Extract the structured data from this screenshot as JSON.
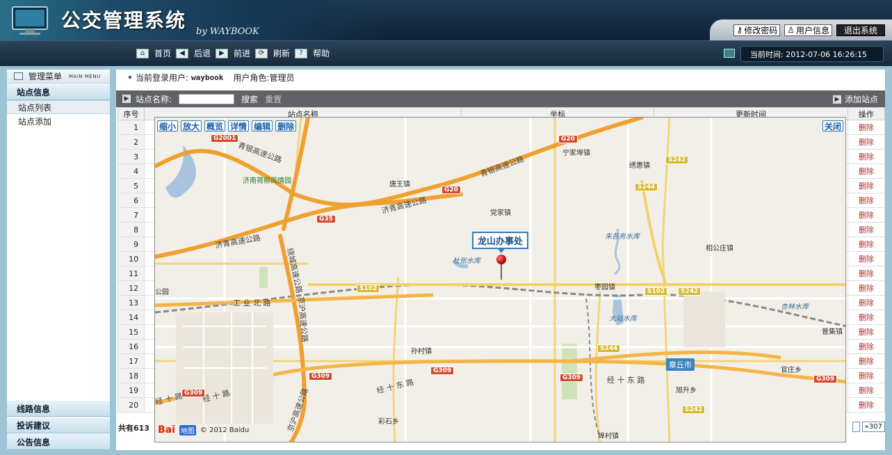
{
  "header": {
    "title": "公交管理系统",
    "subtitle": "by WAYBOOK",
    "buttons": {
      "change_password": "修改密码",
      "user_info": "用户信息",
      "logout": "退出系统"
    },
    "nav": [
      {
        "label": "首页",
        "icon": "home-icon"
      },
      {
        "label": "后退",
        "icon": "back-icon"
      },
      {
        "label": "前进",
        "icon": "forward-icon"
      },
      {
        "label": "刷新",
        "icon": "refresh-icon"
      },
      {
        "label": "帮助",
        "icon": "help-icon"
      }
    ],
    "current_time": "当前时间: 2012-07-06 16:26:15"
  },
  "sidebar": {
    "title": "管理菜单",
    "title_en": "MAIN MENU",
    "sections": {
      "station": "站点信息",
      "station_list": "站点列表",
      "station_add": "站点添加",
      "route": "线路信息",
      "complaints": "投诉建议",
      "notices": "公告信息"
    }
  },
  "content": {
    "login_label": "当前登录用户:",
    "login_user": "waybook",
    "role_label": "用户角色:",
    "role": "管理员",
    "search_label": "站点名称:",
    "search_placeholder": "",
    "search_button": "搜索",
    "reset_button": "重置",
    "add_button": "添加站点",
    "columns": [
      "序号",
      "站点名称",
      "坐标",
      "更新时间",
      "操作"
    ],
    "rows": [
      "1",
      "2",
      "3",
      "4",
      "5",
      "6",
      "7",
      "8",
      "9",
      "10",
      "11",
      "12",
      "13",
      "14",
      "15",
      "16",
      "17",
      "18",
      "19",
      "20"
    ],
    "delete_label": "删除",
    "total": "共有613",
    "last_page": "»307"
  },
  "map": {
    "tools": {
      "zoom_out": "缩小",
      "zoom_in": "放大",
      "overview": "概览",
      "detail": "详情",
      "edit": "编辑",
      "delete": "删除"
    },
    "close": "关闭",
    "marker_label": "龙山办事处",
    "copyright": "© 2012 Baidu",
    "logo": "Bai",
    "logo2": "地图",
    "places": {
      "p1": "宁家埠镇",
      "p2": "绣惠镇",
      "p3": "唐王镇",
      "p4": "党家镇",
      "p5": "济南荷柳风情园",
      "p6": "朱各务水库",
      "p7": "相公庄镇",
      "p8": "杜张水库",
      "p9": "枣园镇",
      "p10": "杏林水库",
      "p11": "大站水库",
      "p12": "普集镇",
      "p13": "孙村镇",
      "p14": "章丘市",
      "p15": "官庄乡",
      "p16": "旭升乡",
      "p17": "彩石乡",
      "p18": "埠村镇",
      "p19": "公园"
    },
    "roads": {
      "r1": "青银高速公路",
      "r2": "青银高速公路",
      "r3": "济青高速公路",
      "r4": "济青高速公路",
      "r5": "绕城高速公路",
      "r6": "京沪高速公路",
      "r7": "京沪高速公路",
      "r8": "工 业 北 路",
      "r9": "经 十 东 路",
      "r10": "经 十 东 路",
      "r11": "经 十 路",
      "r12": "经 十 路"
    },
    "shields": {
      "s1": "G2001",
      "s2": "G20",
      "s3": "G20",
      "s4": "G35",
      "s5": "S102",
      "s6": "S102",
      "s7": "S242",
      "s8": "S242",
      "s9": "S244",
      "s10": "S244",
      "s11": "G309",
      "s12": "G309",
      "s13": "G309",
      "s14": "G309",
      "s15": "G309",
      "s16": "S242"
    }
  }
}
